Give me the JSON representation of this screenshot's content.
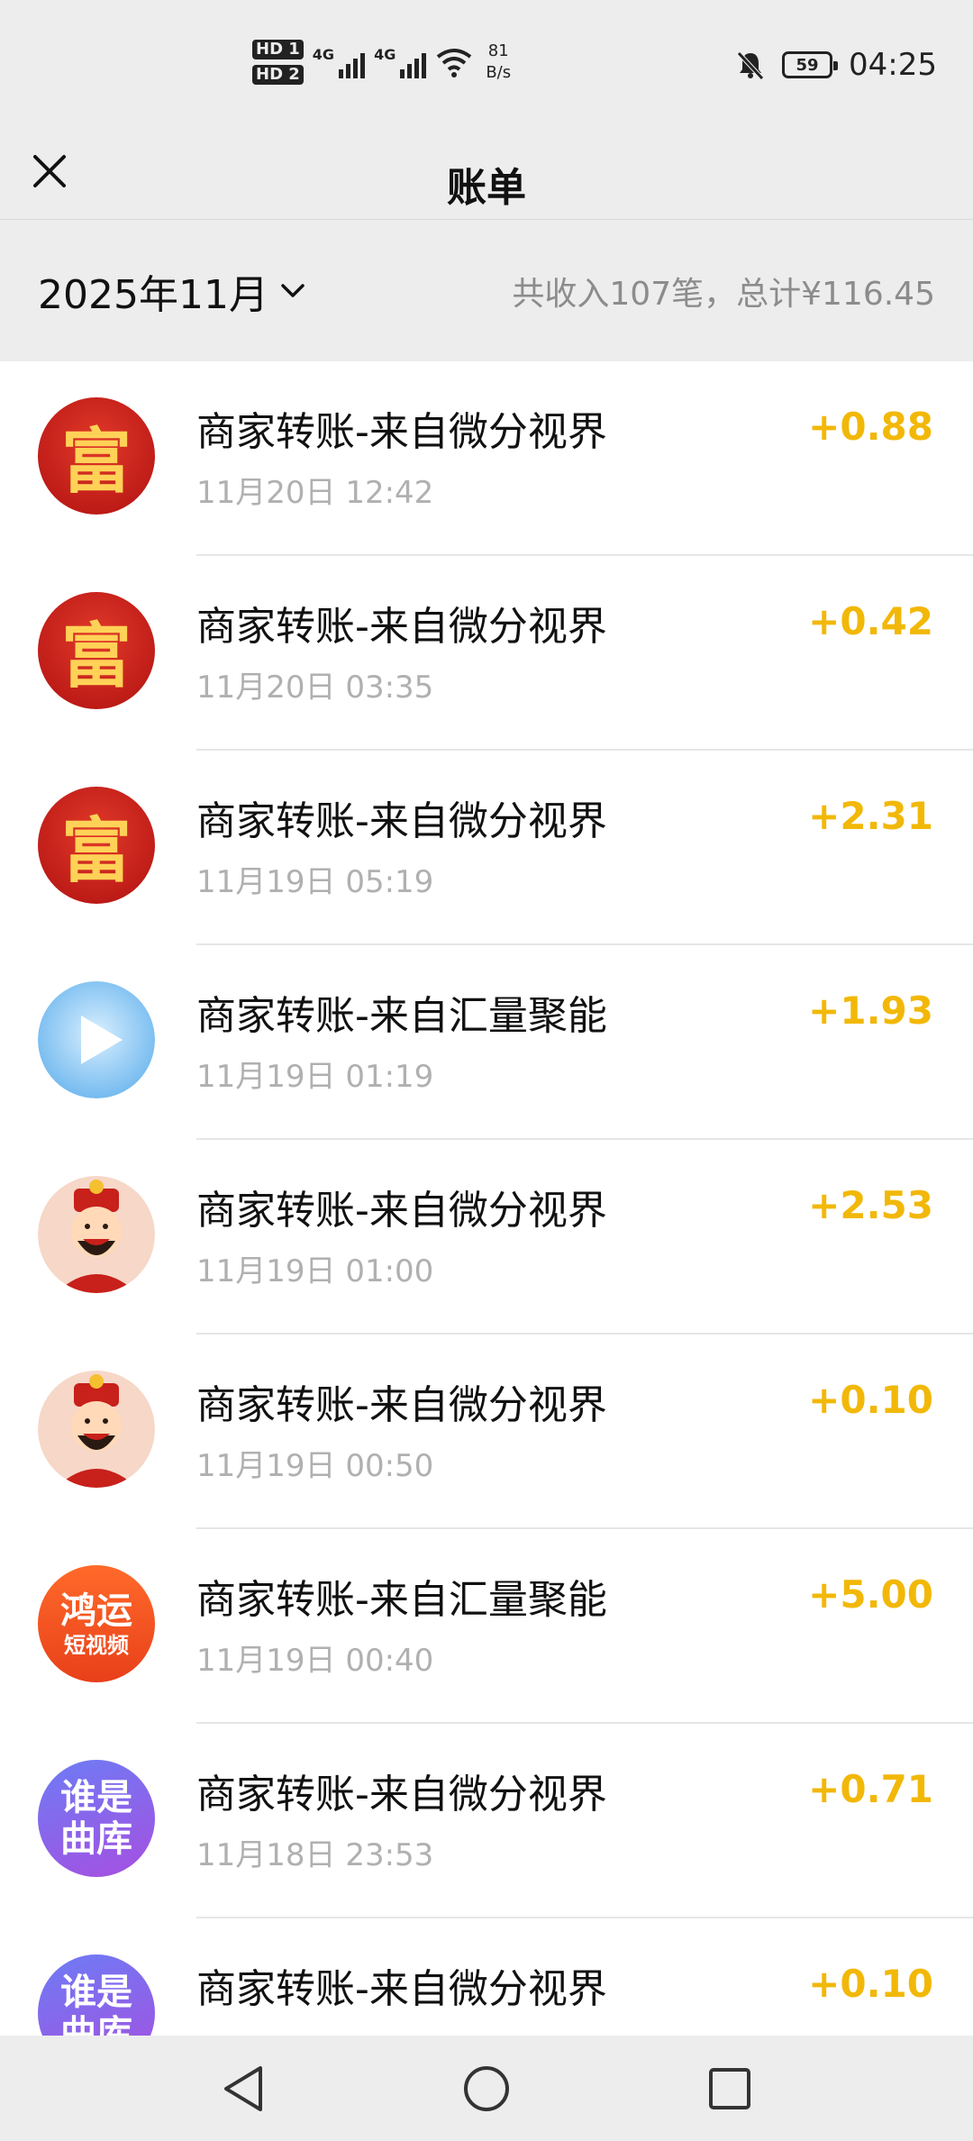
{
  "status_bar": {
    "sim_labels": [
      "HD 1",
      "HD 2"
    ],
    "net_labels": [
      "4G",
      "4G"
    ],
    "speed_value": "81",
    "speed_unit": "B/s",
    "battery_level": "59",
    "time": "04:25",
    "icons": [
      "signal-icon",
      "wifi-icon",
      "bell-muted-icon",
      "battery-icon"
    ]
  },
  "header": {
    "title": "账单",
    "close_icon": "close-icon"
  },
  "summary": {
    "month": "2025年11月",
    "totals_text": "共收入107笔，总计¥116.45"
  },
  "transactions": [
    {
      "title": "商家转账-来自微分视界",
      "time": "11月20日 12:42",
      "amount": "+0.88",
      "avatar": "fu-coin"
    },
    {
      "title": "商家转账-来自微分视界",
      "time": "11月20日 03:35",
      "amount": "+0.42",
      "avatar": "fu-coin"
    },
    {
      "title": "商家转账-来自微分视界",
      "time": "11月19日 05:19",
      "amount": "+2.31",
      "avatar": "fu-coin"
    },
    {
      "title": "商家转账-来自汇量聚能",
      "time": "11月19日 01:19",
      "amount": "+1.93",
      "avatar": "play"
    },
    {
      "title": "商家转账-来自微分视界",
      "time": "11月19日 01:00",
      "amount": "+2.53",
      "avatar": "fortune-god"
    },
    {
      "title": "商家转账-来自微分视界",
      "time": "11月19日 00:50",
      "amount": "+0.10",
      "avatar": "fortune-god"
    },
    {
      "title": "商家转账-来自汇量聚能",
      "time": "11月19日 00:40",
      "amount": "+5.00",
      "avatar": "hongyun"
    },
    {
      "title": "商家转账-来自微分视界",
      "time": "11月18日 23:53",
      "amount": "+0.71",
      "avatar": "shuishi"
    },
    {
      "title": "商家转账-来自微分视界",
      "time": "",
      "amount": "+0.10",
      "avatar": "shuishi"
    }
  ],
  "avatar_text": {
    "fu": "富",
    "hongyun_top": "鸿运",
    "hongyun_bottom": "短视频",
    "shuishi_top": "谁是",
    "shuishi_bottom": "曲库"
  },
  "colors": {
    "amount": "#f2b808",
    "background": "#ededed",
    "list_background": "#ffffff"
  },
  "nav": [
    "back-icon",
    "home-icon",
    "recent-apps-icon"
  ]
}
